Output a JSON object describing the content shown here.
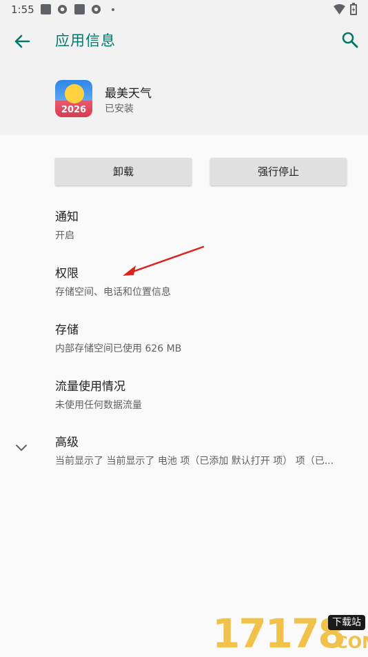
{
  "status_bar": {
    "time": "1:55"
  },
  "header": {
    "title": "应用信息",
    "app_name": "最美天气",
    "app_status": "已安装",
    "app_icon_text": "2026"
  },
  "buttons": {
    "uninstall": "卸载",
    "force_stop": "强行停止"
  },
  "items": [
    {
      "title": "通知",
      "subtitle": "开启"
    },
    {
      "title": "权限",
      "subtitle": "存储空间、电话和位置信息"
    },
    {
      "title": "存储",
      "subtitle": "内部存储空间已使用 626 MB"
    },
    {
      "title": "流量使用情况",
      "subtitle": "未使用任何数据流量"
    },
    {
      "title": "高级",
      "subtitle": "当前显示了 当前显示了 电池 项（已添加 默认打开 项） 项（已..."
    }
  ],
  "watermark": {
    "number": "17178",
    "tag": "下载站",
    "suffix": ".COM"
  },
  "colors": {
    "accent": "#00796b",
    "annotation_arrow": "#e0201c",
    "header_bg": "#f2f2f2"
  }
}
